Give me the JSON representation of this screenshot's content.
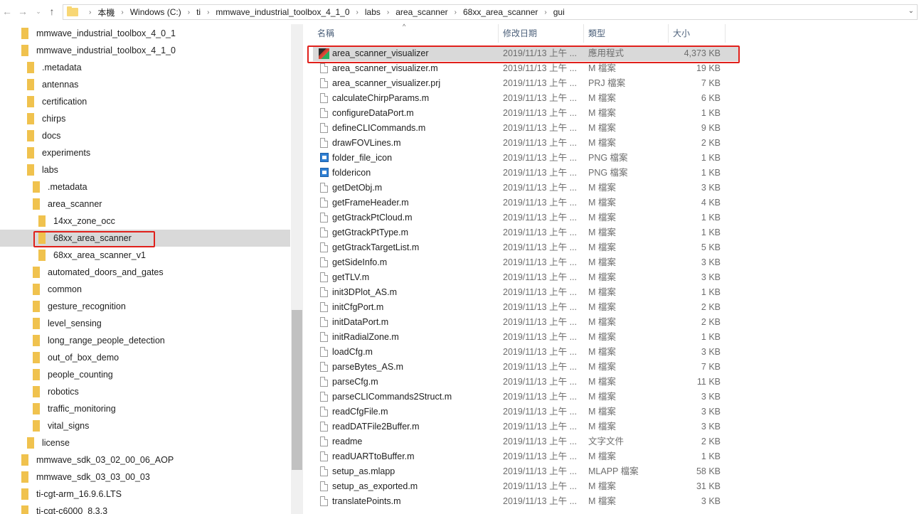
{
  "address_bar": {
    "crumbs": [
      "本機",
      "Windows (C:)",
      "ti",
      "mmwave_industrial_toolbox_4_1_0",
      "labs",
      "area_scanner",
      "68xx_area_scanner",
      "gui"
    ]
  },
  "nav_tree": [
    {
      "label": "mmwave_industrial_toolbox_4_0_1",
      "level": 0
    },
    {
      "label": "mmwave_industrial_toolbox_4_1_0",
      "level": 0
    },
    {
      "label": ".metadata",
      "level": 1
    },
    {
      "label": "antennas",
      "level": 1
    },
    {
      "label": "certification",
      "level": 1
    },
    {
      "label": "chirps",
      "level": 1
    },
    {
      "label": "docs",
      "level": 1
    },
    {
      "label": "experiments",
      "level": 1
    },
    {
      "label": "labs",
      "level": 1
    },
    {
      "label": ".metadata",
      "level": 2
    },
    {
      "label": "area_scanner",
      "level": 2
    },
    {
      "label": "14xx_zone_occ",
      "level": 3
    },
    {
      "label": "68xx_area_scanner",
      "level": 3,
      "selected": true
    },
    {
      "label": "68xx_area_scanner_v1",
      "level": 3
    },
    {
      "label": "automated_doors_and_gates",
      "level": 2
    },
    {
      "label": "common",
      "level": 2
    },
    {
      "label": "gesture_recognition",
      "level": 2
    },
    {
      "label": "level_sensing",
      "level": 2
    },
    {
      "label": "long_range_people_detection",
      "level": 2
    },
    {
      "label": "out_of_box_demo",
      "level": 2
    },
    {
      "label": "people_counting",
      "level": 2
    },
    {
      "label": "robotics",
      "level": 2
    },
    {
      "label": "traffic_monitoring",
      "level": 2
    },
    {
      "label": "vital_signs",
      "level": 2
    },
    {
      "label": "license",
      "level": 1
    },
    {
      "label": "mmwave_sdk_03_02_00_06_AOP",
      "level": 0
    },
    {
      "label": "mmwave_sdk_03_03_00_03",
      "level": 0
    },
    {
      "label": "ti-cgt-arm_16.9.6.LTS",
      "level": 0
    },
    {
      "label": "ti-cgt-c6000_8.3.3",
      "level": 0
    }
  ],
  "columns": {
    "name": "名稱",
    "date": "修改日期",
    "type": "類型",
    "size": "大小"
  },
  "files": [
    {
      "name": "area_scanner_visualizer",
      "date": "2019/11/13 上午 ...",
      "type": "應用程式",
      "size": "4,373 KB",
      "icon": "app-icon",
      "selected": true
    },
    {
      "name": "area_scanner_visualizer.m",
      "date": "2019/11/13 上午 ...",
      "type": "M 檔案",
      "size": "19 KB",
      "icon": "doc-icon"
    },
    {
      "name": "area_scanner_visualizer.prj",
      "date": "2019/11/13 上午 ...",
      "type": "PRJ 檔案",
      "size": "7 KB",
      "icon": "doc-icon"
    },
    {
      "name": "calculateChirpParams.m",
      "date": "2019/11/13 上午 ...",
      "type": "M 檔案",
      "size": "6 KB",
      "icon": "doc-icon"
    },
    {
      "name": "configureDataPort.m",
      "date": "2019/11/13 上午 ...",
      "type": "M 檔案",
      "size": "1 KB",
      "icon": "doc-icon"
    },
    {
      "name": "defineCLICommands.m",
      "date": "2019/11/13 上午 ...",
      "type": "M 檔案",
      "size": "9 KB",
      "icon": "doc-icon"
    },
    {
      "name": "drawFOVLines.m",
      "date": "2019/11/13 上午 ...",
      "type": "M 檔案",
      "size": "2 KB",
      "icon": "doc-icon"
    },
    {
      "name": "folder_file_icon",
      "date": "2019/11/13 上午 ...",
      "type": "PNG 檔案",
      "size": "1 KB",
      "icon": "image-icon"
    },
    {
      "name": "foldericon",
      "date": "2019/11/13 上午 ...",
      "type": "PNG 檔案",
      "size": "1 KB",
      "icon": "image-icon"
    },
    {
      "name": "getDetObj.m",
      "date": "2019/11/13 上午 ...",
      "type": "M 檔案",
      "size": "3 KB",
      "icon": "doc-icon"
    },
    {
      "name": "getFrameHeader.m",
      "date": "2019/11/13 上午 ...",
      "type": "M 檔案",
      "size": "4 KB",
      "icon": "doc-icon"
    },
    {
      "name": "getGtrackPtCloud.m",
      "date": "2019/11/13 上午 ...",
      "type": "M 檔案",
      "size": "1 KB",
      "icon": "doc-icon"
    },
    {
      "name": "getGtrackPtType.m",
      "date": "2019/11/13 上午 ...",
      "type": "M 檔案",
      "size": "1 KB",
      "icon": "doc-icon"
    },
    {
      "name": "getGtrackTargetList.m",
      "date": "2019/11/13 上午 ...",
      "type": "M 檔案",
      "size": "5 KB",
      "icon": "doc-icon"
    },
    {
      "name": "getSideInfo.m",
      "date": "2019/11/13 上午 ...",
      "type": "M 檔案",
      "size": "3 KB",
      "icon": "doc-icon"
    },
    {
      "name": "getTLV.m",
      "date": "2019/11/13 上午 ...",
      "type": "M 檔案",
      "size": "3 KB",
      "icon": "doc-icon"
    },
    {
      "name": "init3DPlot_AS.m",
      "date": "2019/11/13 上午 ...",
      "type": "M 檔案",
      "size": "1 KB",
      "icon": "doc-icon"
    },
    {
      "name": "initCfgPort.m",
      "date": "2019/11/13 上午 ...",
      "type": "M 檔案",
      "size": "2 KB",
      "icon": "doc-icon"
    },
    {
      "name": "initDataPort.m",
      "date": "2019/11/13 上午 ...",
      "type": "M 檔案",
      "size": "2 KB",
      "icon": "doc-icon"
    },
    {
      "name": "initRadialZone.m",
      "date": "2019/11/13 上午 ...",
      "type": "M 檔案",
      "size": "1 KB",
      "icon": "doc-icon"
    },
    {
      "name": "loadCfg.m",
      "date": "2019/11/13 上午 ...",
      "type": "M 檔案",
      "size": "3 KB",
      "icon": "doc-icon"
    },
    {
      "name": "parseBytes_AS.m",
      "date": "2019/11/13 上午 ...",
      "type": "M 檔案",
      "size": "7 KB",
      "icon": "doc-icon"
    },
    {
      "name": "parseCfg.m",
      "date": "2019/11/13 上午 ...",
      "type": "M 檔案",
      "size": "11 KB",
      "icon": "doc-icon"
    },
    {
      "name": "parseCLICommands2Struct.m",
      "date": "2019/11/13 上午 ...",
      "type": "M 檔案",
      "size": "3 KB",
      "icon": "doc-icon"
    },
    {
      "name": "readCfgFile.m",
      "date": "2019/11/13 上午 ...",
      "type": "M 檔案",
      "size": "3 KB",
      "icon": "doc-icon"
    },
    {
      "name": "readDATFile2Buffer.m",
      "date": "2019/11/13 上午 ...",
      "type": "M 檔案",
      "size": "3 KB",
      "icon": "doc-icon"
    },
    {
      "name": "readme",
      "date": "2019/11/13 上午 ...",
      "type": "文字文件",
      "size": "2 KB",
      "icon": "doc-icon"
    },
    {
      "name": "readUARTtoBuffer.m",
      "date": "2019/11/13 上午 ...",
      "type": "M 檔案",
      "size": "1 KB",
      "icon": "doc-icon"
    },
    {
      "name": "setup_as.mlapp",
      "date": "2019/11/13 上午 ...",
      "type": "MLAPP 檔案",
      "size": "58 KB",
      "icon": "doc-icon"
    },
    {
      "name": "setup_as_exported.m",
      "date": "2019/11/13 上午 ...",
      "type": "M 檔案",
      "size": "31 KB",
      "icon": "doc-icon"
    },
    {
      "name": "translatePoints.m",
      "date": "2019/11/13 上午 ...",
      "type": "M 檔案",
      "size": "3 KB",
      "icon": "doc-icon"
    }
  ],
  "colors": {
    "highlight_border": "#e0201b",
    "selection_bg": "#d9d9d9",
    "folder": "#f0c24e"
  }
}
